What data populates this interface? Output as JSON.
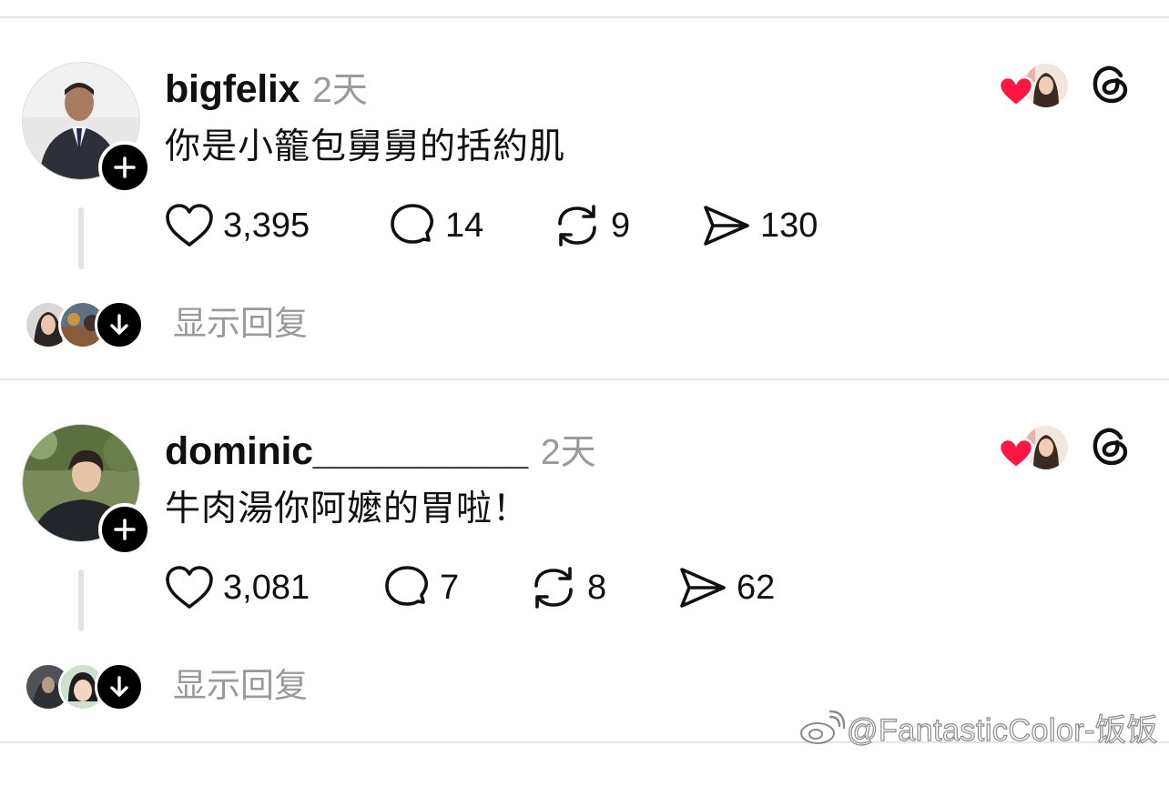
{
  "posts": [
    {
      "username": "bigfelix",
      "time": "2天",
      "text": "你是小籠包舅舅的括約肌",
      "likes": "3,395",
      "comments": "14",
      "reposts": "9",
      "shares": "130",
      "show_replies": "显示回复"
    },
    {
      "username": "dominic__________",
      "time": "2天",
      "text": "牛肉湯你阿嬤的胃啦！",
      "likes": "3,081",
      "comments": "7",
      "reposts": "8",
      "shares": "62",
      "show_replies": "显示回复"
    }
  ],
  "watermark": {
    "text": "@FantasticColor-饭饭"
  },
  "colors": {
    "text": "#101010",
    "muted": "#9a9a9a",
    "heart": "#ff1744",
    "divider": "#e6e6e6"
  },
  "icons": [
    "plus-icon",
    "heart-icon",
    "comment-icon",
    "repost-icon",
    "send-icon",
    "threads-logo-icon",
    "arrow-down-icon",
    "weibo-logo-icon"
  ]
}
